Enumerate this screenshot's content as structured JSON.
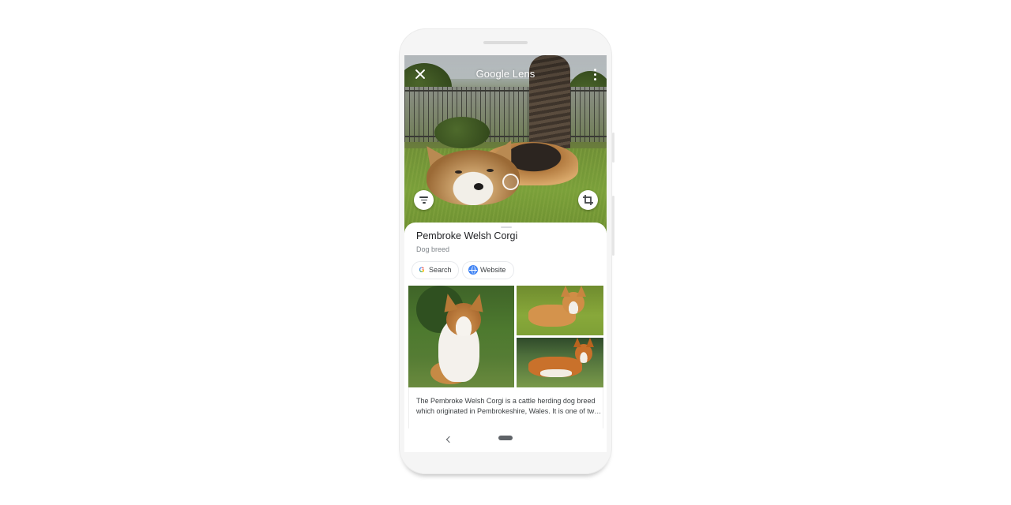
{
  "header": {
    "title": "Google Lens"
  },
  "result": {
    "title": "Pembroke Welsh Corgi",
    "subtitle": "Dog breed",
    "chips": [
      {
        "label": "Search",
        "icon": "google-g-icon"
      },
      {
        "label": "Website",
        "icon": "globe-icon"
      }
    ],
    "description_lines": [
      "The Pembroke Welsh Corgi is a cattle herding dog breed",
      "which originated in Pembrokeshire, Wales. It is one of two..."
    ]
  },
  "icons": {
    "close": "close-icon",
    "more": "more-vert-icon",
    "filter": "filter-icon",
    "crop": "crop-icon",
    "back": "back-icon",
    "home": "home-pill-icon"
  },
  "colors": {
    "google_blue": "#4285f4",
    "google_red": "#ea4335",
    "google_yellow": "#fbbc05",
    "google_green": "#34a853",
    "title_text": "#202124",
    "secondary_text": "#80868b"
  }
}
